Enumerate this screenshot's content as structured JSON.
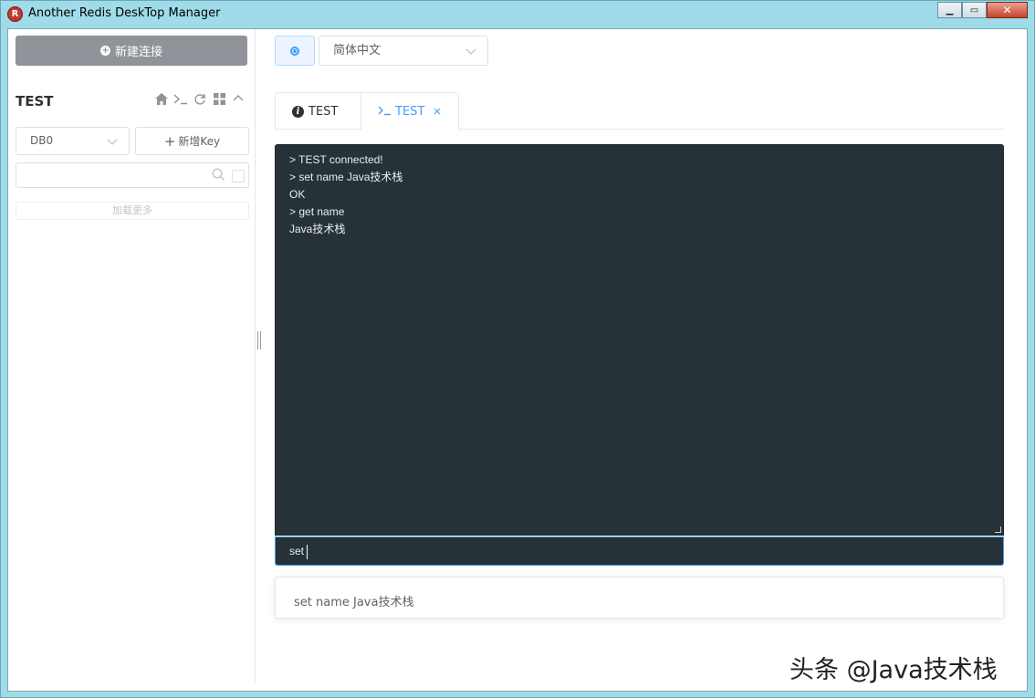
{
  "window": {
    "title": "Another Redis DeskTop Manager",
    "controls": {
      "minimize": "▁",
      "maximize": "▭",
      "close": "✕"
    }
  },
  "sidebar": {
    "new_connection_label": "新建连接",
    "connection_name": "TEST",
    "toolbar_icons": [
      "home-icon",
      "terminal-icon",
      "refresh-icon",
      "grid-icon",
      "collapse-icon"
    ],
    "db_select": {
      "value": "DB0"
    },
    "new_key_label": "新增Key",
    "search": {
      "placeholder": ""
    },
    "load_more_label": "加载更多"
  },
  "header": {
    "language_select": {
      "value": "简体中文"
    }
  },
  "tabs": [
    {
      "label": "TEST",
      "icon": "info-icon",
      "active": false
    },
    {
      "label": "TEST",
      "icon": "terminal-icon",
      "active": true,
      "closable": true
    }
  ],
  "console": {
    "lines": [
      "> TEST connected!",
      "> set name Java技术栈",
      "OK",
      "> get name",
      "Java技术栈"
    ]
  },
  "command_input": {
    "value": "set"
  },
  "suggestions": [
    "set name Java技术栈"
  ],
  "watermark": "头条 @Java技术栈",
  "colors": {
    "accent": "#409eff",
    "console_bg": "#263238",
    "new_connection_bg": "#909399",
    "window_frame": "#9fdbe8"
  }
}
